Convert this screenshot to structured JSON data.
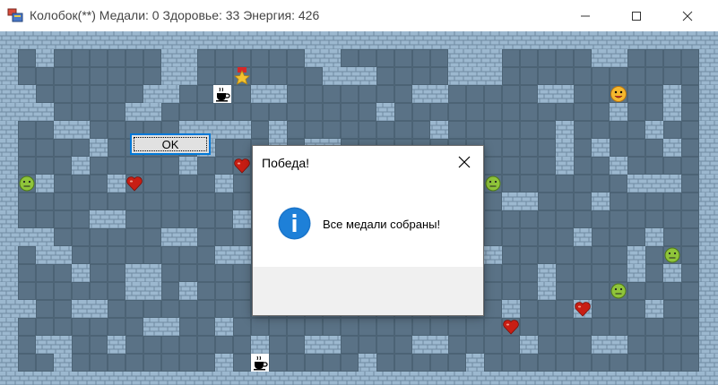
{
  "window": {
    "title": "Колобок(**) Медали: 0 Здоровье: 33 Энергия: 426",
    "icon": "app-icon"
  },
  "game": {
    "wall_color": "#94b3cc",
    "floor_color": "#5a7286",
    "items": [
      {
        "kind": "medal",
        "name": "medal-star-icon"
      },
      {
        "kind": "coffee",
        "name": "coffee-cup-icon"
      },
      {
        "kind": "coffee",
        "name": "coffee-cup-icon"
      },
      {
        "kind": "player",
        "name": "kolobok-player-icon"
      },
      {
        "kind": "heart",
        "name": "heart-icon"
      },
      {
        "kind": "heart",
        "name": "heart-icon"
      },
      {
        "kind": "heart",
        "name": "heart-icon"
      },
      {
        "kind": "heart",
        "name": "heart-icon"
      },
      {
        "kind": "enemy",
        "name": "green-smiley-enemy-icon"
      },
      {
        "kind": "enemy",
        "name": "green-smiley-enemy-icon"
      },
      {
        "kind": "enemy",
        "name": "green-smiley-enemy-icon"
      },
      {
        "kind": "enemy",
        "name": "green-smiley-enemy-icon"
      }
    ]
  },
  "dialog": {
    "title": "Победа!",
    "message": "Все медали собраны!",
    "ok_label": "OK",
    "icon": "info-icon",
    "accent": "#0078d7"
  }
}
